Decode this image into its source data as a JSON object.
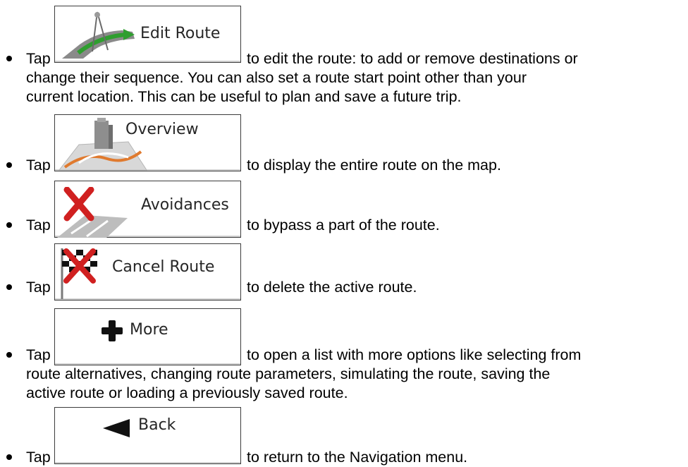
{
  "tap_word": "Tap",
  "items": [
    {
      "button_label": "Edit Route",
      "icon": "edit-route-icon",
      "line1": "to edit the route: to add or remove destinations or",
      "more": [
        "change their sequence. You can also set a route start point other than your",
        "current location. This can be useful to plan and save a future trip."
      ]
    },
    {
      "button_label": "Overview",
      "icon": "overview-icon",
      "line1": "to display the entire route on the map.",
      "more": []
    },
    {
      "button_label": "Avoidances",
      "icon": "avoidances-icon",
      "line1": "to bypass a part of the route.",
      "more": []
    },
    {
      "button_label": "Cancel Route",
      "icon": "cancel-route-icon",
      "line1": "to delete the active route.",
      "more": []
    },
    {
      "button_label": "More",
      "icon": "plus-icon",
      "line1": "to open a list with more options like selecting from",
      "more": [
        "route alternatives, changing route parameters, simulating the route, saving the",
        "active route or loading a previously saved route."
      ]
    },
    {
      "button_label": "Back",
      "icon": "back-arrow-icon",
      "line1": "to return to the Navigation menu.",
      "more": []
    }
  ]
}
